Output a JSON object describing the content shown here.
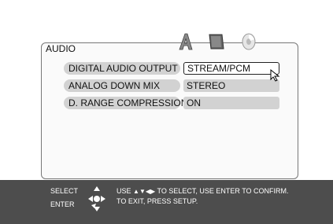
{
  "menu": {
    "title": "AUDIO",
    "tabs": [
      {
        "icon": "speaker-a-icon"
      },
      {
        "icon": "display-screen-icon"
      },
      {
        "icon": "disc-icon"
      }
    ],
    "rows": [
      {
        "label": "DIGITAL AUDIO OUTPUT",
        "value": "STREAM/PCM",
        "selected": true
      },
      {
        "label": "ANALOG DOWN MIX",
        "value": "STEREO",
        "selected": false
      },
      {
        "label": "D. RANGE COMPRESSION",
        "value": "ON",
        "selected": false
      }
    ]
  },
  "help": {
    "select_label": "SELECT",
    "enter_label": "ENTER",
    "line1_prefix": "USE",
    "line1_arrows": "▲▼◀▶",
    "line1_suffix": "TO SELECT,  USE ENTER TO CONFIRM.",
    "line2": "TO EXIT, PRESS SETUP."
  },
  "colors": {
    "help_bar_bg": "#4d4d4d",
    "field_bg": "#d2d2d2",
    "selected_field_bg": "#ffffff"
  }
}
